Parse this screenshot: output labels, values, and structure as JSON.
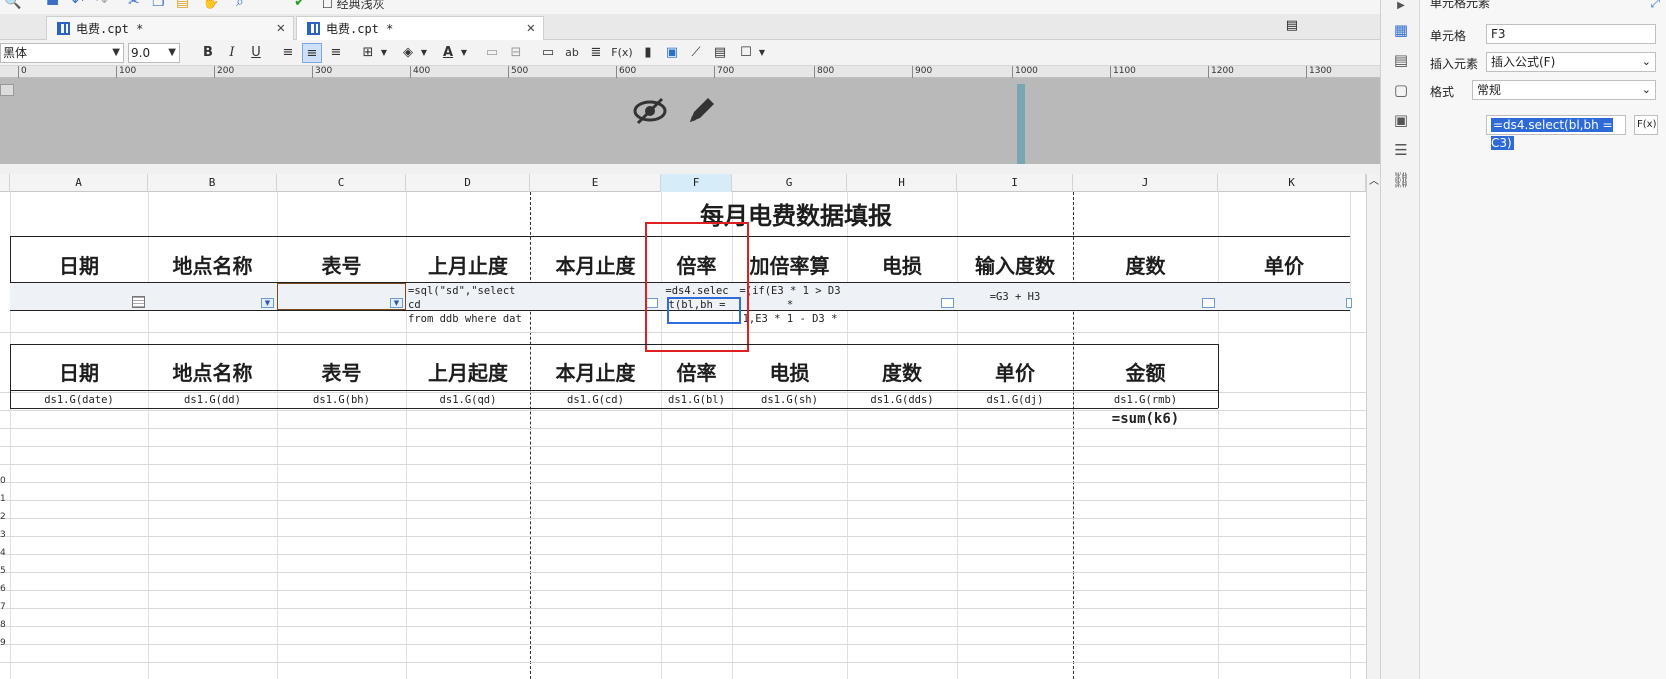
{
  "toolbar_top": {
    "label": "经典浅灰"
  },
  "tabs": [
    {
      "label": "电费.cpt *",
      "active": false
    },
    {
      "label": "电费.cpt *",
      "active": true
    }
  ],
  "format_toolbar": {
    "font_name": "黑体",
    "font_size": "9.0",
    "bold": "B",
    "italic": "I",
    "underline": "U",
    "text_style_label": "ab",
    "formula_label": "F(x)"
  },
  "ruler": {
    "ticks": [
      "0",
      "100",
      "200",
      "300",
      "400",
      "500",
      "600",
      "700",
      "800",
      "900",
      "1000",
      "1100",
      "1200",
      "1300"
    ]
  },
  "columns": [
    "A",
    "B",
    "C",
    "D",
    "E",
    "F",
    "G",
    "H",
    "I",
    "J",
    "K"
  ],
  "selected_column": "F",
  "sheet": {
    "title": "每月电费数据填报",
    "input_headers": [
      "日期",
      "地点名称",
      "表号",
      "上月止度",
      "本月止度",
      "倍率",
      "加倍率算",
      "电损",
      "输入度数",
      "度数",
      "单价"
    ],
    "input_row": {
      "d": [
        "=sql(\"sd\",\"select cd",
        " from ddb where dat"
      ],
      "f": [
        "=ds4.selec",
        "t(bl,bh ="
      ],
      "g": [
        "=(if(E3 * 1 > D3 *",
        " 1,E3 * 1 - D3 *"
      ],
      "i": "=G3 + H3"
    },
    "report_headers": [
      "日期",
      "地点名称",
      "表号",
      "上月起度",
      "本月止度",
      "倍率",
      "电损",
      "度数",
      "单价",
      "金额"
    ],
    "report_cells": [
      "ds1.G(date)",
      "ds1.G(dd)",
      "ds1.G(bh)",
      "ds1.G(qd)",
      "ds1.G(cd)",
      "ds1.G(bl)",
      "ds1.G(sh)",
      "ds1.G(dds)",
      "ds1.G(dj)",
      "ds1.G(rmb)"
    ],
    "sum_formula": "=sum(k6)",
    "row_numbers": [
      "0",
      "1",
      "2",
      "3",
      "4",
      "5",
      "6",
      "7",
      "8",
      "9"
    ]
  },
  "properties_panel": {
    "header": "单元格元素",
    "cell_label": "单元格",
    "cell_value": "F3",
    "insert_label": "插入元素",
    "insert_value": "插入公式(F)",
    "format_label": "格式",
    "format_value": "常规",
    "formula_value": "=ds4.select(bl,bh = C3)",
    "fx_button": "F(x)"
  },
  "icons": {
    "hide": "eye-slash-icon",
    "edit": "pencil-icon"
  },
  "colors": {
    "accent": "#2e6ddb",
    "highlight": "#e02020",
    "header_bg": "#b9b9b9"
  }
}
